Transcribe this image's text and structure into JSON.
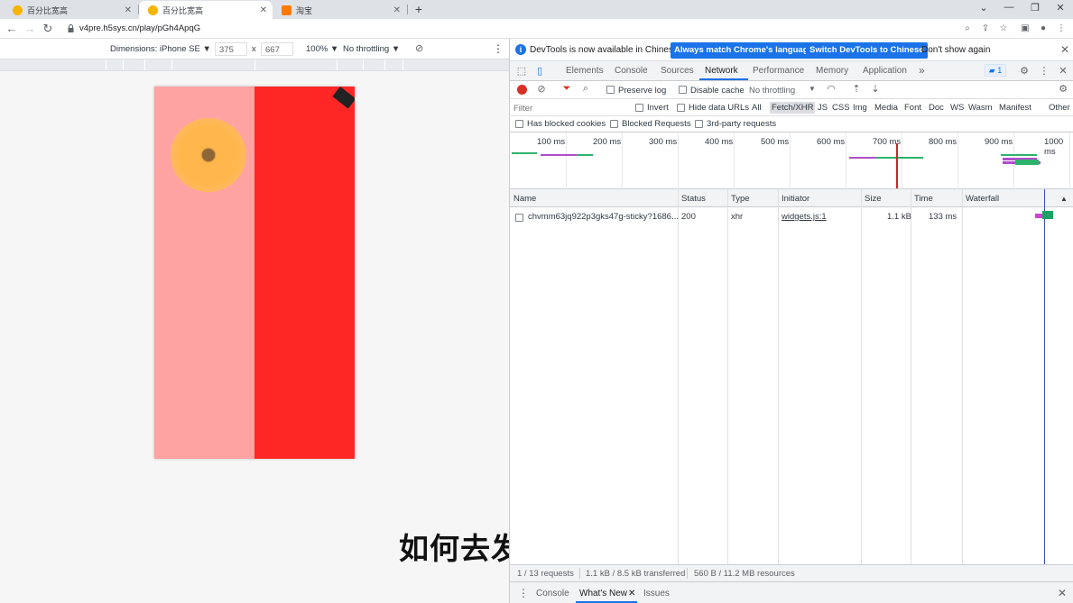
{
  "browser": {
    "tabs": [
      {
        "title": "百分比宽高",
        "favicon_color": "#f5b400",
        "active": false
      },
      {
        "title": "百分比宽高",
        "favicon_color": "#f5b400",
        "active": true
      },
      {
        "title": "淘宝",
        "favicon_color": "#ff7a00",
        "active": false
      }
    ],
    "new_tab": "+",
    "url": "v4pre.h5sys.cn/play/pGh4ApqG"
  },
  "device_toolbar": {
    "dimensions_label": "Dimensions: iPhone SE ▼",
    "width": "375",
    "times": "x",
    "height": "667",
    "zoom": "100% ▼",
    "throttling": "No throttling ▼",
    "more": "⋮"
  },
  "page": {
    "left_color": "#ffa2a2",
    "right_color": "#ff2626",
    "circle_color": "#ffb74d"
  },
  "subtitle": "如何去发生一个变化",
  "devtools": {
    "infobar": {
      "message": "DevTools is now available in Chinese!",
      "btn_match": "Always match Chrome's language",
      "btn_switch": "Switch DevTools to Chinese",
      "dont_show": "Don't show again"
    },
    "tabs": [
      "Elements",
      "Console",
      "Sources",
      "Network",
      "Performance",
      "Memory",
      "Application"
    ],
    "more_tabs": "»",
    "message_count": "1",
    "network_toolbar": {
      "preserve_log": "Preserve log",
      "disable_cache": "Disable cache",
      "throttling": "No throttling"
    },
    "filter": {
      "placeholder": "Filter",
      "invert": "Invert",
      "hide_data_urls": "Hide data URLs",
      "types": [
        "All",
        "Fetch/XHR",
        "JS",
        "CSS",
        "Img",
        "Media",
        "Font",
        "Doc",
        "WS",
        "Wasm",
        "Manifest",
        "Other"
      ],
      "active_type": "Fetch/XHR",
      "has_blocked_cookies": "Has blocked cookies",
      "blocked_requests": "Blocked Requests",
      "third_party": "3rd-party requests"
    },
    "overview_ticks": [
      "100 ms",
      "200 ms",
      "300 ms",
      "400 ms",
      "500 ms",
      "600 ms",
      "700 ms",
      "800 ms",
      "900 ms",
      "1000 ms"
    ],
    "table": {
      "headers": [
        "Name",
        "Status",
        "Type",
        "Initiator",
        "Size",
        "Time",
        "Waterfall"
      ],
      "sort_indicator": "▲",
      "rows": [
        {
          "name": "chvmm63jq922p3gks47g-sticky?1686...",
          "status": "200",
          "type": "xhr",
          "initiator": "widgets.js:1",
          "size": "1.1 kB",
          "time": "133 ms"
        }
      ]
    },
    "status": {
      "requests": "1 / 13 requests",
      "transferred": "1.1 kB / 8.5 kB transferred",
      "resources": "560 B / 11.2 MB resources"
    },
    "drawer": {
      "tabs": [
        "Console",
        "What's New",
        "Issues"
      ],
      "active": "What's New"
    }
  }
}
